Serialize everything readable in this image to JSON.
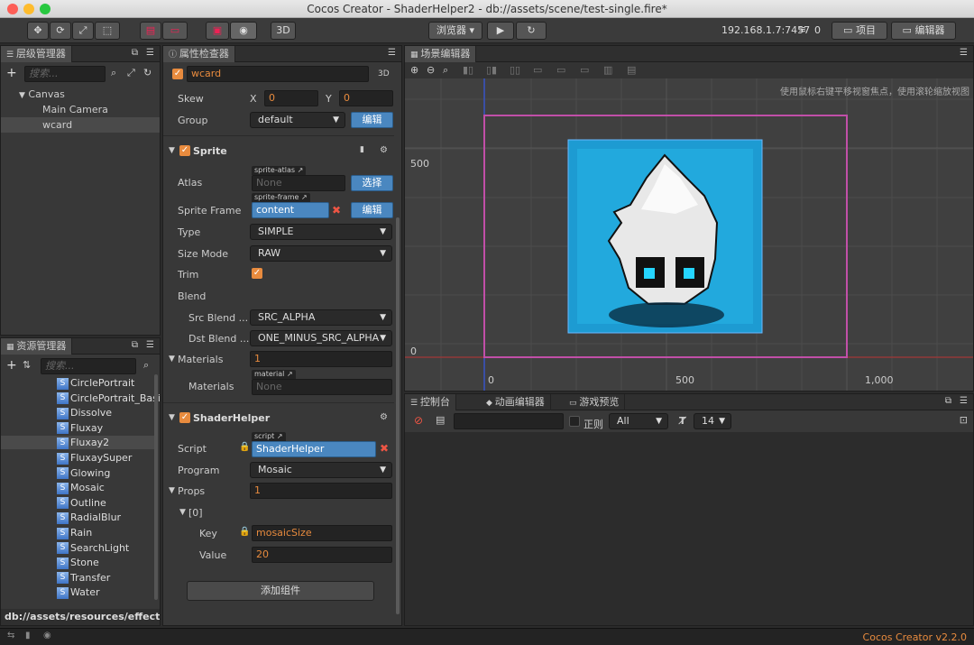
{
  "window": {
    "title": "Cocos Creator - ShaderHelper2 - db://assets/scene/test-single.fire*"
  },
  "toolbar": {
    "btn3d": "3D",
    "browser": "浏览器",
    "ip": "192.168.1.7:7457",
    "wifi_count": "0",
    "project": "项目",
    "editor": "编辑器"
  },
  "hierarchy": {
    "tab": "层级管理器",
    "search_placeholder": "搜索...",
    "items": [
      "Canvas",
      "Main Camera",
      "wcard"
    ]
  },
  "assets": {
    "tab": "资源管理器",
    "search_placeholder": "搜索...",
    "items": [
      "CirclePortrait",
      "CirclePortrait_Basic",
      "Dissolve",
      "Fluxay",
      "Fluxay2",
      "FluxaySuper",
      "Glowing",
      "Mosaic",
      "Outline",
      "RadialBlur",
      "Rain",
      "SearchLight",
      "Stone",
      "Transfer",
      "Water"
    ],
    "selected": "Fluxay2",
    "path": "db://assets/resources/effects..."
  },
  "inspector": {
    "tab": "属性检查器",
    "node_name": "wcard",
    "badge3d": "3D",
    "skew_label": "Skew",
    "skew_x_label": "X",
    "skew_x": "0",
    "skew_y_label": "Y",
    "skew_y": "0",
    "group_label": "Group",
    "group_value": "default",
    "edit": "编辑",
    "sprite": {
      "title": "Sprite",
      "atlas_label": "Atlas",
      "atlas_tag": "sprite-atlas",
      "atlas_value": "None",
      "select": "选择",
      "frame_label": "Sprite Frame",
      "frame_tag": "sprite-frame",
      "frame_value": "content",
      "type_label": "Type",
      "type_value": "SIMPLE",
      "sizemode_label": "Size Mode",
      "sizemode_value": "RAW",
      "trim_label": "Trim",
      "blend_label": "Blend",
      "src_label": "Src Blend ...",
      "src_value": "SRC_ALPHA",
      "dst_label": "Dst Blend ...",
      "dst_value": "ONE_MINUS_SRC_ALPHA",
      "materials_label": "Materials",
      "materials_count": "1",
      "material_tag": "material",
      "materials_item_label": "Materials",
      "material_value": "None"
    },
    "shader": {
      "title": "ShaderHelper",
      "script_label": "Script",
      "script_tag": "script",
      "script_value": "ShaderHelper",
      "program_label": "Program",
      "program_value": "Mosaic",
      "props_label": "Props",
      "props_count": "1",
      "index_label": "[0]",
      "key_label": "Key",
      "key_value": "mosaicSize",
      "value_label": "Value",
      "value_value": "20"
    },
    "add_component": "添加组件"
  },
  "scene": {
    "tab": "场景编辑器",
    "hint": "使用鼠标右键平移视窗焦点，使用滚轮缩放视图",
    "label_500_y": "500",
    "label_0_y": "0",
    "label_0_x": "0",
    "label_500_x": "500",
    "label_1000_x": "1,000"
  },
  "console": {
    "tab_console": "控制台",
    "tab_anim": "动画编辑器",
    "tab_preview": "游戏预览",
    "regex": "正则",
    "level": "All",
    "font_size": "14"
  },
  "statusbar": {
    "version": "Cocos Creator v2.2.0"
  },
  "colors": {
    "accent": "#e88b3e",
    "blue": "#4a87c0",
    "frame": "#c14fa8"
  }
}
